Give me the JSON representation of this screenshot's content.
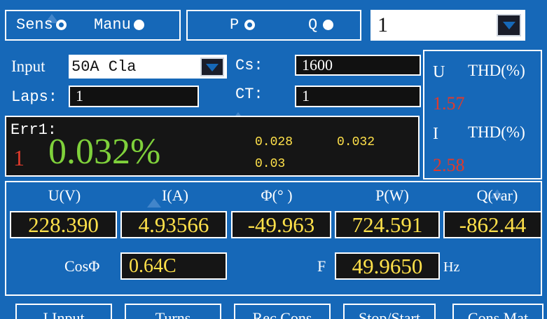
{
  "mode": {
    "sens_label": "Sens",
    "manu_label": "Manu",
    "p_label": "P",
    "q_label": "Q",
    "selector_value": "1"
  },
  "input": {
    "label": "Input",
    "value": "50A  Cla"
  },
  "cs": {
    "label": "Cs:",
    "value": "1600"
  },
  "laps": {
    "label": "Laps:",
    "value": "1"
  },
  "ct": {
    "label": "CT:",
    "value": "1"
  },
  "thd": {
    "u_label": "U",
    "u_unit": "THD(%)",
    "u_value": "1.57",
    "i_label": "I",
    "i_unit": "THD(%)",
    "i_value": "2.58"
  },
  "error": {
    "title": "Err1:",
    "index": "1",
    "main_value": "0.032%",
    "v1": "0.028",
    "v2": "0.032",
    "v3": "0.03"
  },
  "measurements": {
    "headers": [
      "U(V)",
      "I(A)",
      "Φ(° )",
      "P(W)",
      "Q(var)"
    ],
    "values": [
      "228.390",
      "4.93566",
      "-49.963",
      "724.591",
      "-862.44"
    ],
    "cos_label": "CosΦ",
    "cos_value": "0.64C",
    "f_label": "F",
    "f_value": "49.9650",
    "f_unit": "Hz"
  },
  "buttons": [
    "I Input",
    "Turns",
    "Rec Cons",
    "Stop/Start",
    "Cons Mat"
  ],
  "colors": {
    "background": "#1668b8",
    "field": "#151515",
    "measure_text": "#ffe14a",
    "error_green": "#7fd13b",
    "red": "#e03a2c"
  }
}
